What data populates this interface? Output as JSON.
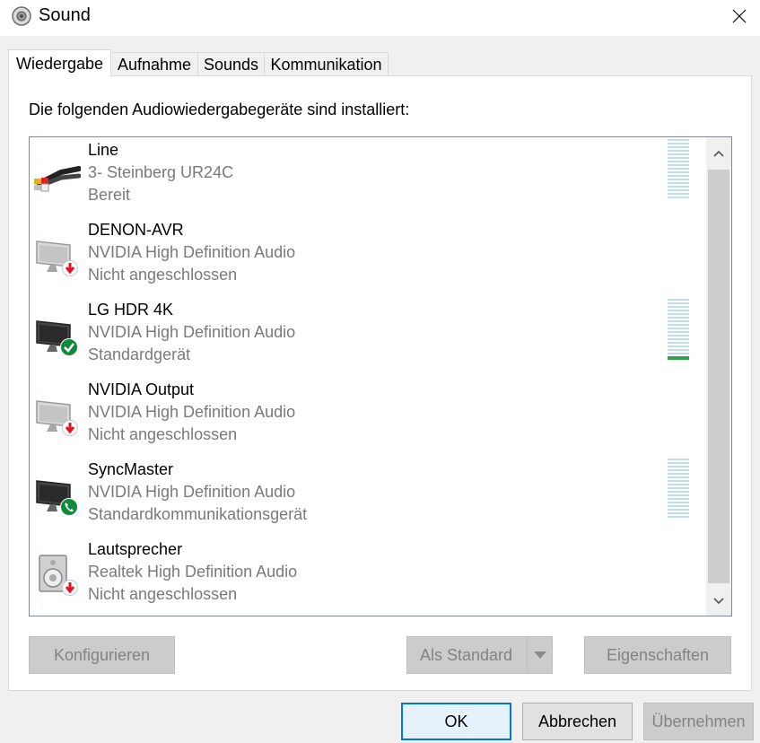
{
  "window": {
    "title": "Sound"
  },
  "tabs": [
    {
      "label": "Wiedergabe",
      "active": true
    },
    {
      "label": "Aufnahme",
      "active": false
    },
    {
      "label": "Sounds",
      "active": false
    },
    {
      "label": "Kommunikation",
      "active": false
    }
  ],
  "playback": {
    "intro": "Die folgenden Audiowiedergabegeräte sind installiert:",
    "devices": [
      {
        "name": "Line",
        "driver": "3- Steinberg UR24C",
        "status": "Bereit",
        "icon": "line-cable-icon",
        "badge": null
      },
      {
        "name": "DENON-AVR",
        "driver": "NVIDIA High Definition Audio",
        "status": "Nicht angeschlossen",
        "icon": "monitor-icon",
        "badge": "unplugged-icon"
      },
      {
        "name": "LG HDR 4K",
        "driver": "NVIDIA High Definition Audio",
        "status": "Standardgerät",
        "icon": "monitor-icon",
        "badge": "default-check-icon"
      },
      {
        "name": "NVIDIA Output",
        "driver": "NVIDIA High Definition Audio",
        "status": "Nicht angeschlossen",
        "icon": "monitor-icon",
        "badge": "unplugged-icon"
      },
      {
        "name": "SyncMaster",
        "driver": "NVIDIA High Definition Audio",
        "status": "Standardkommunikationsgerät",
        "icon": "monitor-icon",
        "badge": "phone-icon"
      },
      {
        "name": "Lautsprecher",
        "driver": "Realtek High Definition Audio",
        "status": "Nicht angeschlossen",
        "icon": "speaker-icon",
        "badge": "unplugged-icon"
      }
    ]
  },
  "buttons": {
    "configure": "Konfigurieren",
    "set_default": "Als Standard",
    "properties": "Eigenschaften",
    "ok": "OK",
    "cancel": "Abbrechen",
    "apply": "Übernehmen"
  },
  "colors": {
    "accent": "#0078d7",
    "meter_off": "#bfe0ea",
    "meter_on": "#31a34a",
    "badge_red": "#e81123",
    "badge_green": "#10893e"
  }
}
